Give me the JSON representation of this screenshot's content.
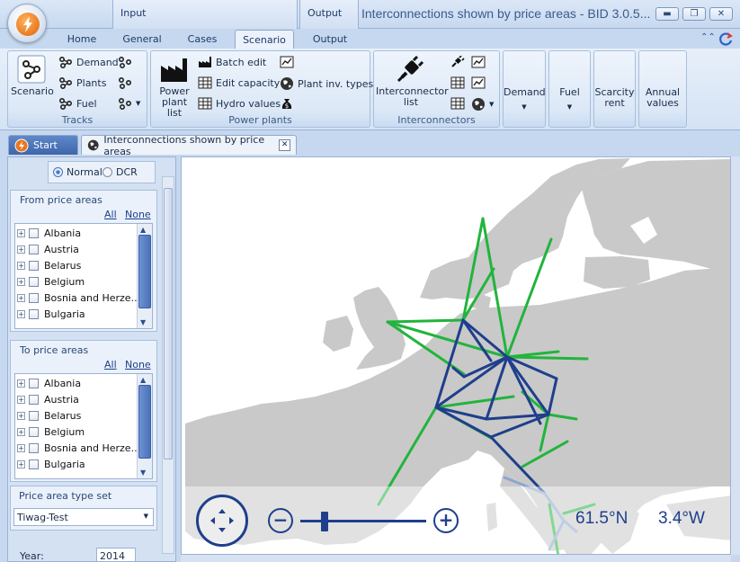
{
  "window": {
    "title": "Interconnections shown by price areas - BID 3.0.5...",
    "minimize_icon": "minimize-icon",
    "maximize_icon": "maximize-icon",
    "close_icon": "close-icon"
  },
  "context_groups": {
    "input": "Input",
    "output": "Output"
  },
  "ribbon_tabs": [
    {
      "label": "Home"
    },
    {
      "label": "General"
    },
    {
      "label": "Cases"
    },
    {
      "label": "Scenario",
      "active": true
    },
    {
      "label": "Output"
    }
  ],
  "ribbon": {
    "tracks": {
      "label": "Tracks",
      "scenario": "Scenario",
      "demand": "Demand",
      "plants": "Plants",
      "fuel": "Fuel"
    },
    "power_plants": {
      "label": "Power plants",
      "power_plant_list": "Power plant list",
      "batch_edit": "Batch edit",
      "edit_capacity": "Edit capacity",
      "hydro_values": "Hydro values",
      "plant_inv_types": "Plant inv. types"
    },
    "interconnectors": {
      "label": "Interconnectors",
      "interconnector_list": "Interconnector list"
    },
    "demand": "Demand",
    "fuel": "Fuel",
    "scarcity_rent": "Scarcity rent",
    "annual_values": "Annual values"
  },
  "doc_tabs": {
    "start": "Start",
    "interconnections": "Interconnections shown by price areas"
  },
  "left_panel": {
    "mode": {
      "normal": "Normal",
      "dcr": "DCR",
      "selected": "Normal"
    },
    "from": {
      "header": "From price areas",
      "all": "All",
      "none": "None",
      "items": [
        "Albania",
        "Austria",
        "Belarus",
        "Belgium",
        "Bosnia and Herze...",
        "Bulgaria"
      ]
    },
    "to": {
      "header": "To price areas",
      "all": "All",
      "none": "None",
      "items": [
        "Albania",
        "Austria",
        "Belarus",
        "Belgium",
        "Bosnia and Herze...",
        "Bulgaria"
      ]
    },
    "type_set": {
      "header": "Price area type set",
      "value": "Tiwag-Test"
    },
    "year": {
      "label": "Year:",
      "value": "2014"
    }
  },
  "map": {
    "lat": "61.5°N",
    "lon": "3.4°W",
    "colors": {
      "land": "#c9c9c9",
      "sea": "#ffffff",
      "green": "#22b43c",
      "blue": "#1f3f8c",
      "light_blue": "#8aa6d0"
    }
  }
}
